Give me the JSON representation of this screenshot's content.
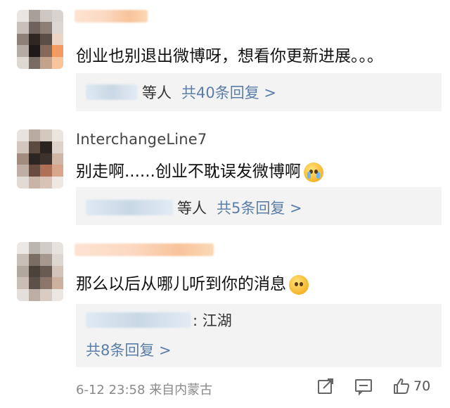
{
  "comments": [
    {
      "text": "创业也别退出微博呀，想看你更新进展。。。",
      "reply_people": "等人",
      "reply_link": "共40条回复 >"
    },
    {
      "username": "InterchangeLine7",
      "text": "别走啊......创业不耽误发微博啊",
      "emoji": "crying-face-icon",
      "reply_people": "等人",
      "reply_link": "共5条回复 >"
    },
    {
      "text": "那么以后从哪儿听到你的消息",
      "emoji": "pleading-face-icon",
      "reply_text": ": 江湖",
      "reply_link": "共8条回复 >",
      "time": "6-12 23:58",
      "location": "来自内蒙古",
      "like_count": "70"
    }
  ],
  "colors": {
    "link": "#5b7ea8",
    "reply_bg": "#f3f3f3",
    "meta": "#8a8a8a"
  },
  "icons": [
    "share-icon",
    "comment-icon",
    "like-icon"
  ]
}
